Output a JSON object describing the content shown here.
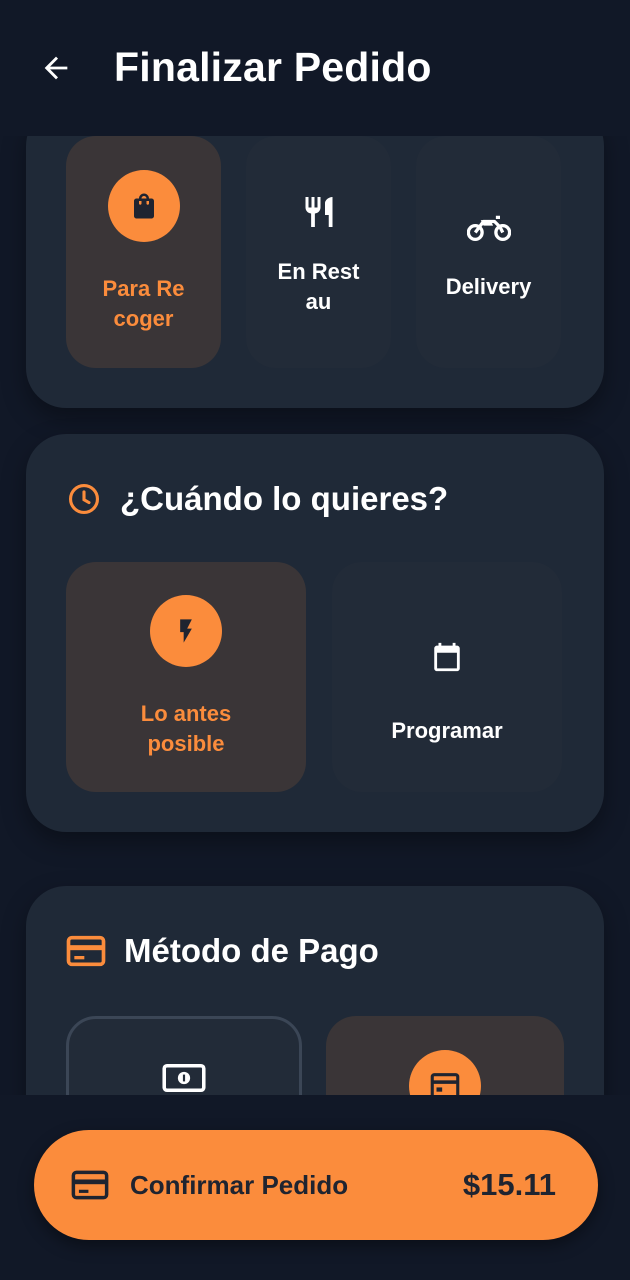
{
  "header": {
    "title": "Finalizar Pedido"
  },
  "order_type": {
    "options": [
      {
        "label": "Para Recoger",
        "icon": "shopping-bag-icon",
        "selected": true
      },
      {
        "label": "En Restau",
        "icon": "utensils-icon",
        "selected": false
      },
      {
        "label": "Delivery",
        "icon": "motorcycle-icon",
        "selected": false
      }
    ]
  },
  "when": {
    "title": "¿Cuándo lo quieres?",
    "icon": "clock-icon",
    "options": [
      {
        "label": "Lo antes posible",
        "icon": "lightning-icon",
        "selected": true
      },
      {
        "label": "Programar",
        "icon": "calendar-icon",
        "selected": false
      }
    ]
  },
  "payment": {
    "title": "Método de Pago",
    "icon": "credit-card-icon",
    "options": [
      {
        "icon": "cash-icon",
        "selected": false
      },
      {
        "icon": "card-icon",
        "selected": true
      }
    ]
  },
  "confirm": {
    "label": "Confirmar Pedido",
    "total": "$15.11",
    "icon": "credit-card-icon"
  },
  "colors": {
    "accent": "#fb8c3c",
    "background": "#111827",
    "card": "#1f2937",
    "selected": "#3a3537"
  }
}
